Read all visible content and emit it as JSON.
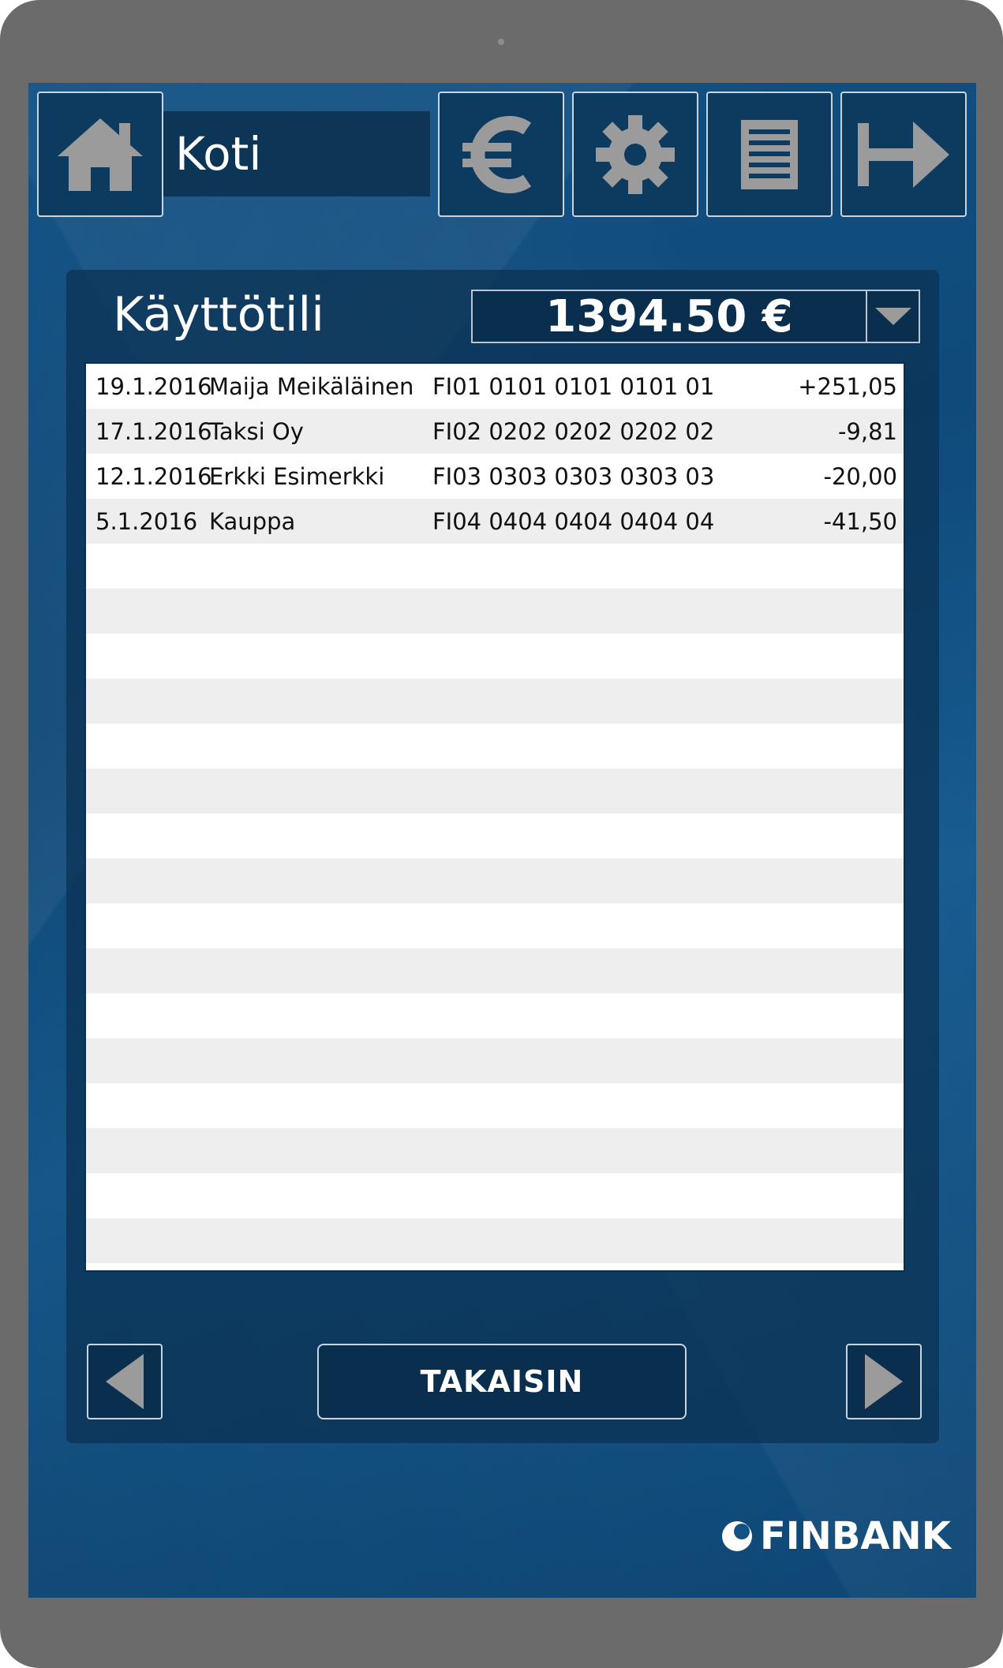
{
  "header": {
    "title": "Koti",
    "icons": [
      "home-icon",
      "euro-icon",
      "gear-icon",
      "document-icon",
      "logout-icon"
    ]
  },
  "account": {
    "name": "Käyttötili",
    "balance": "1394.50 €"
  },
  "transactions": [
    {
      "date": "19.1.2016",
      "name": "Maija Meikäläinen",
      "iban": "FI01 0101 0101 0101 01",
      "amount": "+251,05"
    },
    {
      "date": "17.1.2016",
      "name": "Taksi Oy",
      "iban": "FI02 0202 0202 0202 02",
      "amount": "-9,81"
    },
    {
      "date": "12.1.2016",
      "name": "Erkki Esimerkki",
      "iban": "FI03 0303 0303 0303 03",
      "amount": "-20,00"
    },
    {
      "date": "5.1.2016",
      "name": "Kauppa",
      "iban": "FI04 0404 0404 0404 04",
      "amount": "-41,50"
    }
  ],
  "footer": {
    "back_label": "TAKAISIN"
  },
  "brand": {
    "name": "FINBANK"
  },
  "colors": {
    "screen_bg": "#135285",
    "panel_bg": "#0b3052",
    "tile_bg": "#0d3a5f",
    "icon_gray": "#9b9b9b",
    "device": "#6b6b6b"
  }
}
